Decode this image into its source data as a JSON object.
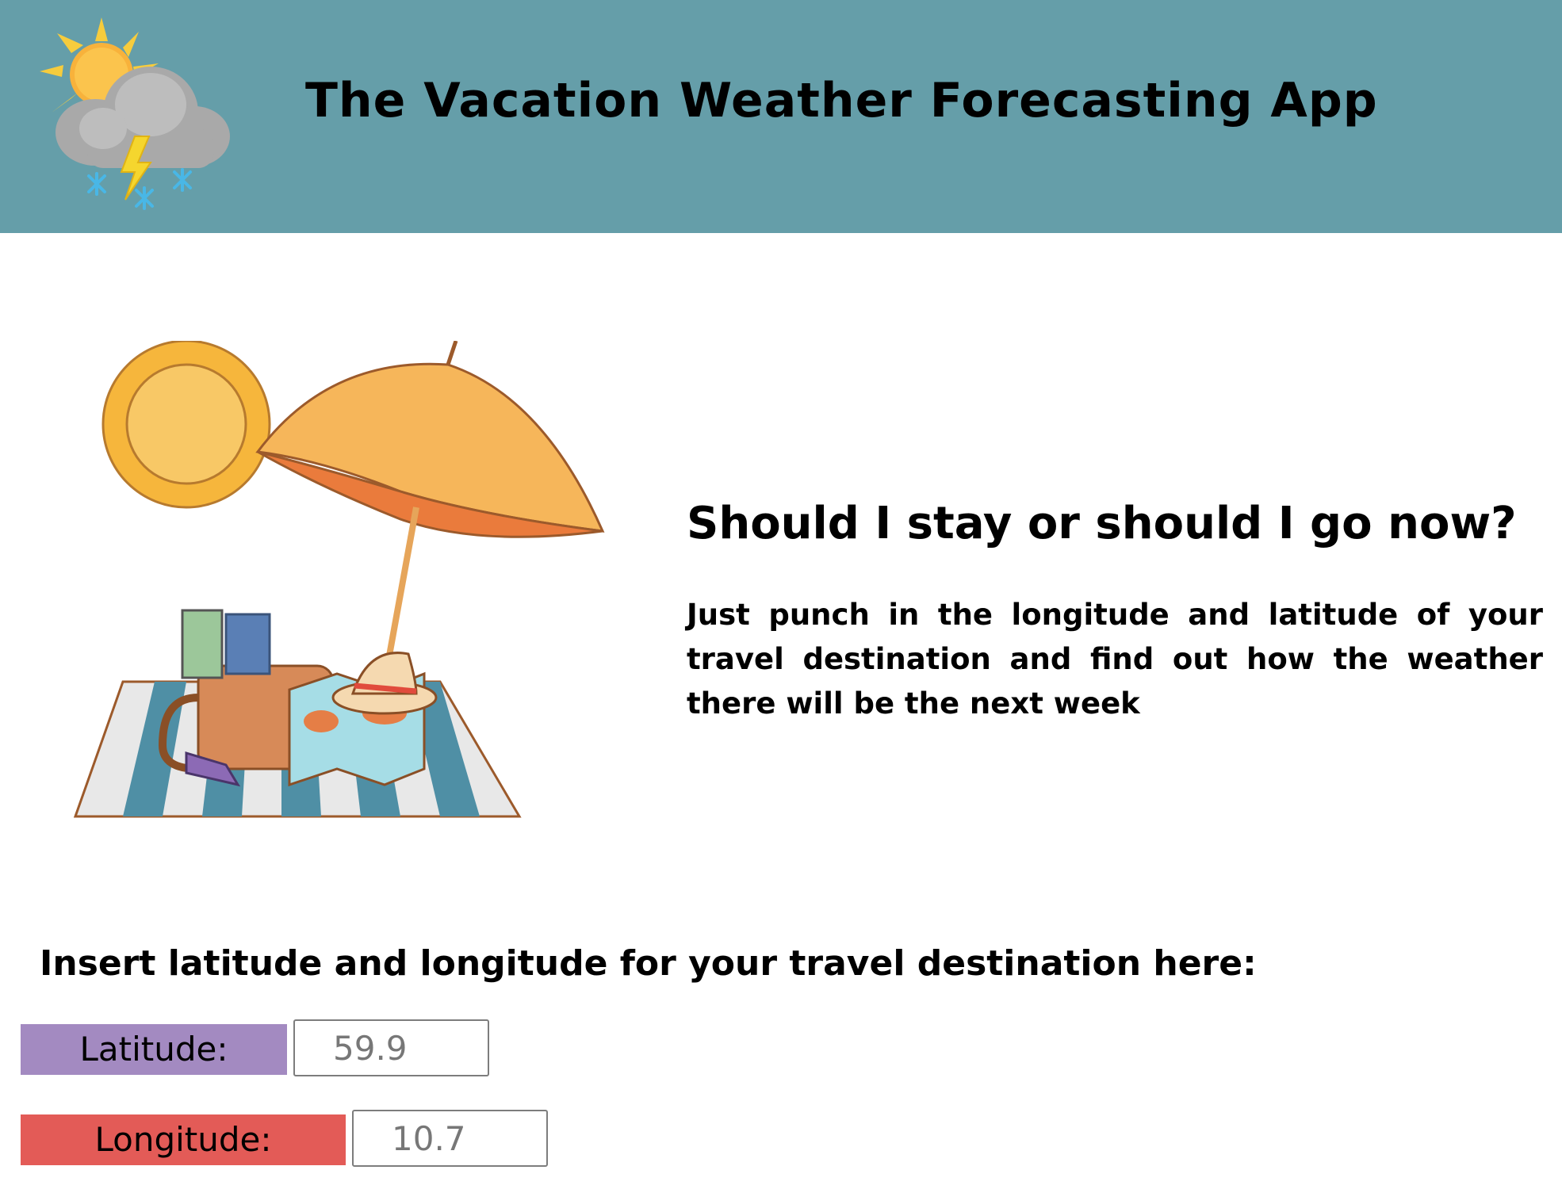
{
  "header": {
    "title": "The Vacation Weather Forecasting App",
    "background_color": "#659ea9",
    "icon": "sun-cloud-lightning-snow-icon"
  },
  "hero": {
    "illustration": "beach-vacation-illustration",
    "heading": "Should I stay or should I go now?",
    "text": "Just punch in the longitude and latitude of your travel destination and find out how the weather there will be the next week"
  },
  "form": {
    "heading": "Insert latitude and longitude for your travel destination here:",
    "latitude": {
      "label": "Latitude:",
      "value": "59.9",
      "label_color": "#a38ac1"
    },
    "longitude": {
      "label": "Longitude:",
      "value": "10.7",
      "label_color": "#e35b57"
    }
  }
}
